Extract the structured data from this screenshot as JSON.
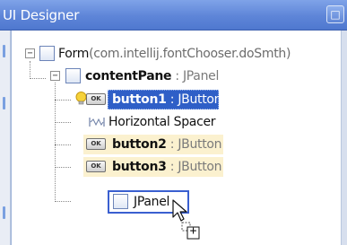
{
  "window": {
    "title": "UI Designer",
    "close_glyph": "□"
  },
  "tree": {
    "form": {
      "name": "Form",
      "class": "(com.intellij.fontChooser.doSmth)",
      "expander": "−",
      "icon": "form-icon"
    },
    "content_pane": {
      "name": "contentPane",
      "type": " : JPanel",
      "expander": "−",
      "icon": "panel-icon"
    },
    "items": [
      {
        "name": "button1",
        "type": " : JButton",
        "icon": "ok-button-icon",
        "badge": "OK",
        "state": "selected"
      },
      {
        "name": "Horizontal Spacer",
        "type": "",
        "icon": "horizontal-spacer-icon",
        "state": "normal"
      },
      {
        "name": "button2",
        "type": " : JButton",
        "icon": "ok-button-icon",
        "badge": "OK",
        "state": "highlighted"
      },
      {
        "name": "button3",
        "type": " : JButton",
        "icon": "ok-button-icon",
        "badge": "OK",
        "state": "highlighted"
      },
      {
        "name": "JPanel",
        "type": "",
        "icon": "panel-icon",
        "state": "drop-target"
      }
    ]
  },
  "indicators": {
    "intention_bulb": "lightbulb-icon",
    "drag_cursor": "drag-copy-cursor-icon",
    "drag_plus": "+"
  },
  "colors": {
    "titlebar": "#5e85d8",
    "selection": "#2f5fc7",
    "highlight": "#fbf1cf",
    "drop_border": "#3a5fd0",
    "type_text": "#7a7a7a"
  }
}
